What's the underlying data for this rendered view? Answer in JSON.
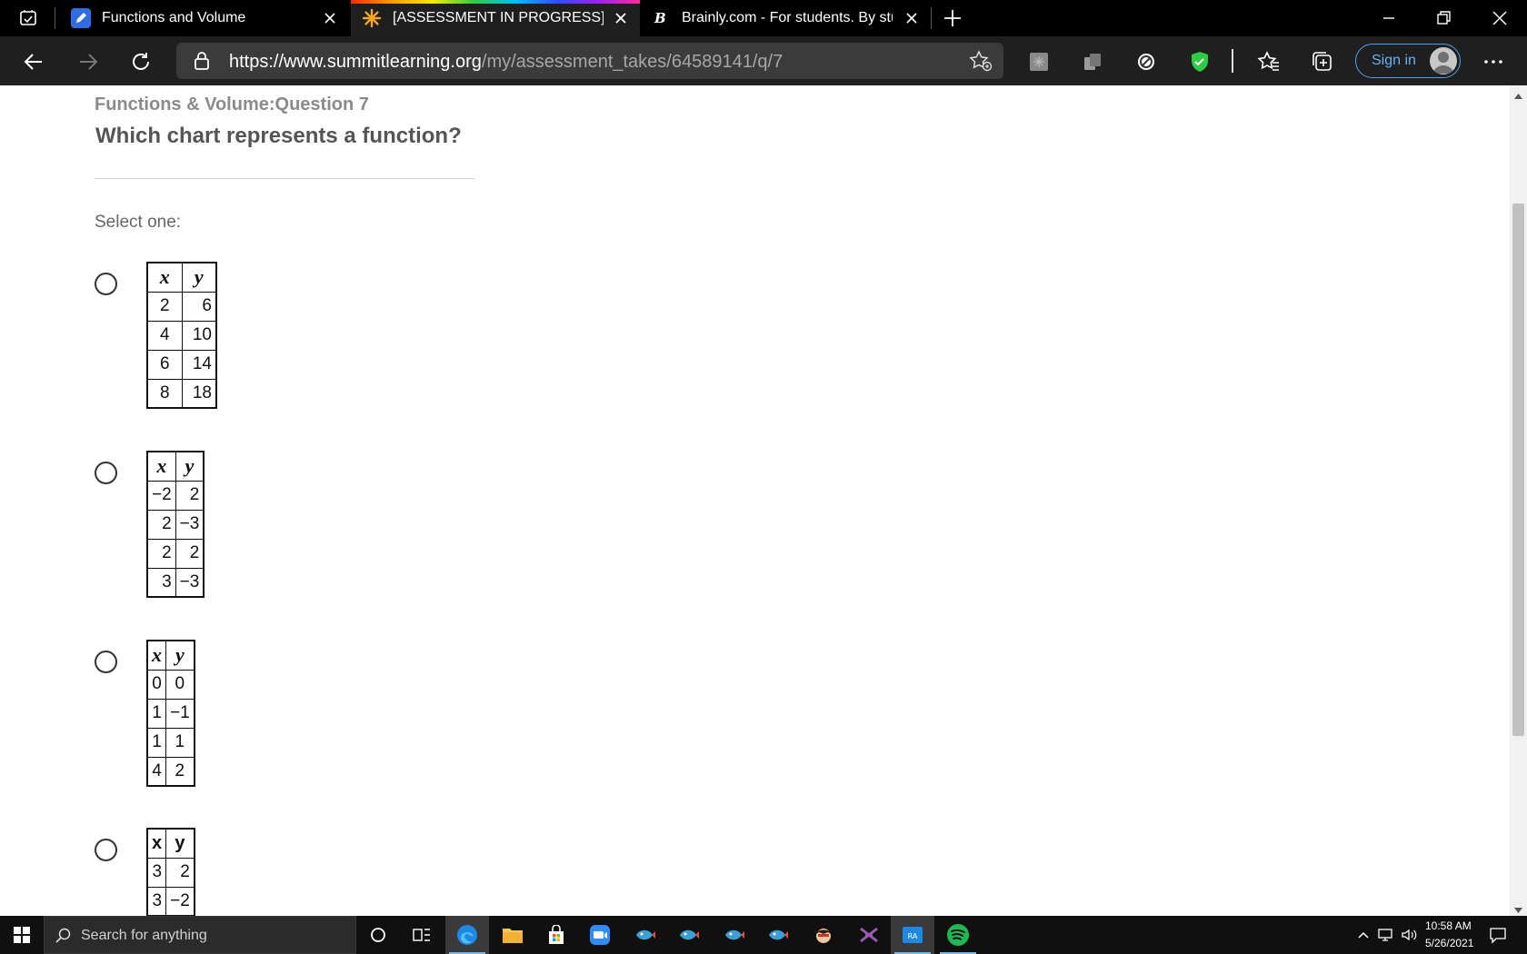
{
  "browser": {
    "tabs": [
      {
        "title": "Functions and Volume",
        "favicon": "edit-icon"
      },
      {
        "title": "[ASSESSMENT IN PROGRESS] Summit Learning",
        "favicon": "summit-sun-icon",
        "active": true
      },
      {
        "title": "Brainly.com - For students. By students.",
        "favicon": "brainly-icon"
      }
    ],
    "url_domain": "https://www.summitlearning.org",
    "url_path": "/my/assessment_takes/64589141/q/7",
    "sign_in_label": "Sign in"
  },
  "question": {
    "subtitle": "Functions & Volume:Question 7",
    "prompt": "Which chart represents a function?",
    "select_label": "Select one:",
    "options": [
      {
        "header": [
          "x",
          "y"
        ],
        "rows": [
          [
            "2",
            "6"
          ],
          [
            "4",
            "10"
          ],
          [
            "6",
            "14"
          ],
          [
            "8",
            "18"
          ]
        ]
      },
      {
        "header": [
          "x",
          "y"
        ],
        "rows": [
          [
            "−2",
            "2"
          ],
          [
            "2",
            "−3"
          ],
          [
            "2",
            "2"
          ],
          [
            "3",
            "−3"
          ]
        ]
      },
      {
        "header": [
          "x",
          "y"
        ],
        "rows": [
          [
            "0",
            "0"
          ],
          [
            "1",
            "−1"
          ],
          [
            "1",
            "1"
          ],
          [
            "4",
            "2"
          ]
        ]
      },
      {
        "header": [
          "x",
          "y"
        ],
        "rows": [
          [
            "3",
            "2"
          ],
          [
            "3",
            "−2"
          ]
        ]
      }
    ]
  },
  "taskbar": {
    "search_placeholder": "Search for anything",
    "time": "10:58 AM",
    "date": "5/26/2021"
  },
  "colors": {
    "accent": "#2f6ce5",
    "signin": "#63b3f5",
    "shield": "#2ecc40",
    "spotify": "#1db954"
  }
}
